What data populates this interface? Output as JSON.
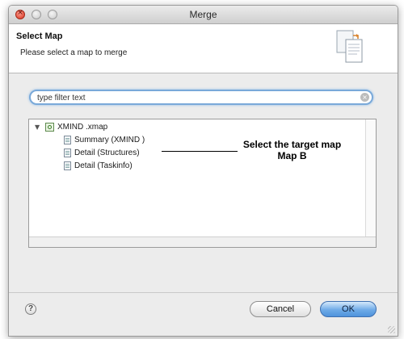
{
  "window": {
    "title": "Merge"
  },
  "banner": {
    "title": "Select Map",
    "description": "Please select a map to merge",
    "icon": "merge-documents-icon"
  },
  "filter": {
    "placeholder": "type filter text",
    "value": ""
  },
  "tree": {
    "root": {
      "label": "XMIND .xmap",
      "icon": "xmind-file-icon",
      "expanded": true
    },
    "children": [
      {
        "label": "Summary (XMIND )",
        "icon": "sheet-icon"
      },
      {
        "label": "Detail (Structures)",
        "icon": "sheet-icon"
      },
      {
        "label": "Detail (Taskinfo)",
        "icon": "sheet-icon"
      }
    ]
  },
  "annotation": {
    "line1": "Select the target map",
    "line2": "Map B"
  },
  "buttons": {
    "cancel": "Cancel",
    "ok": "OK",
    "help": "?"
  },
  "colors": {
    "ok_button": "#5a9be0",
    "search_focus": "#7aa9d9",
    "close_light": "#d6331f"
  }
}
